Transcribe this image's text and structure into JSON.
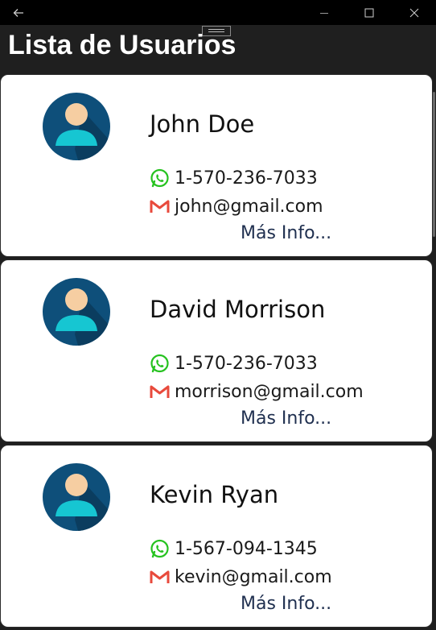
{
  "window": {
    "title": "Lista de Usuarios"
  },
  "colors": {
    "titlebar": "#000000",
    "background": "#1f1f1f",
    "card": "#ffffff",
    "link": "#1f2f4f",
    "whatsapp": "#25c21f",
    "gmail": "#e84a3c"
  },
  "users": [
    {
      "name": "John Doe",
      "phone": "1-570-236-7033",
      "email": "john@gmail.com",
      "more": "Más Info..."
    },
    {
      "name": "David Morrison",
      "phone": "1-570-236-7033",
      "email": "morrison@gmail.com",
      "more": "Más Info..."
    },
    {
      "name": "Kevin Ryan",
      "phone": "1-567-094-1345",
      "email": "kevin@gmail.com",
      "more": "Más Info..."
    }
  ]
}
